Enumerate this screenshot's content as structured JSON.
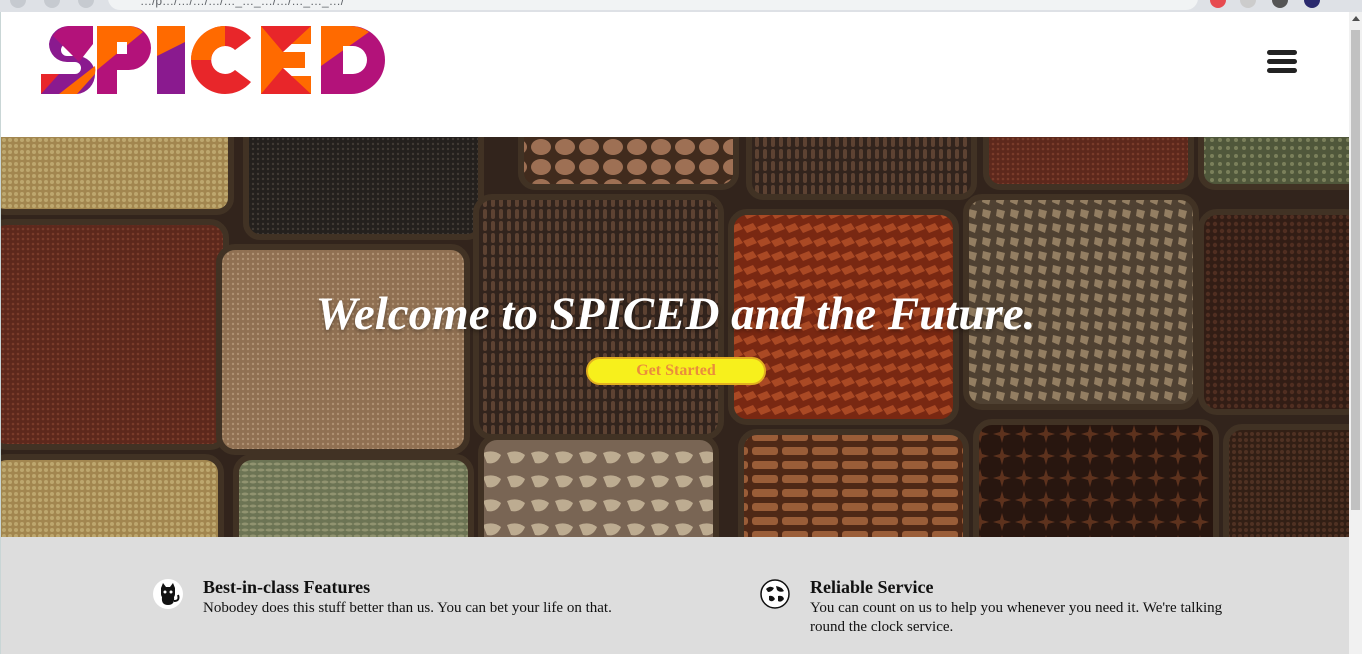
{
  "browser": {
    "url": "…/p…/…/…/…/…_…_…/…/…_…_…/"
  },
  "header": {
    "logo_text": "SPICED",
    "menu_icon": "hamburger-menu-icon"
  },
  "hero": {
    "title": "Welcome to SPICED and the Future.",
    "cta_label": "Get Started"
  },
  "features": [
    {
      "icon": "cat-icon",
      "title": "Best-in-class Features",
      "text": "Nobodey does this stuff better than us. You can bet your life on that."
    },
    {
      "icon": "globe-icon",
      "title": "Reliable Service",
      "text": "You can count on us to help you whenever you need it. We're talking round the clock service."
    }
  ],
  "colors": {
    "cta_fill": "#f7f01c",
    "cta_text": "#ea8c3c",
    "features_bg": "#dddddd",
    "logo_purple": "#8a1a8f",
    "logo_orange": "#ff6a00",
    "logo_red": "#e8262a",
    "logo_magenta": "#b3127a"
  }
}
